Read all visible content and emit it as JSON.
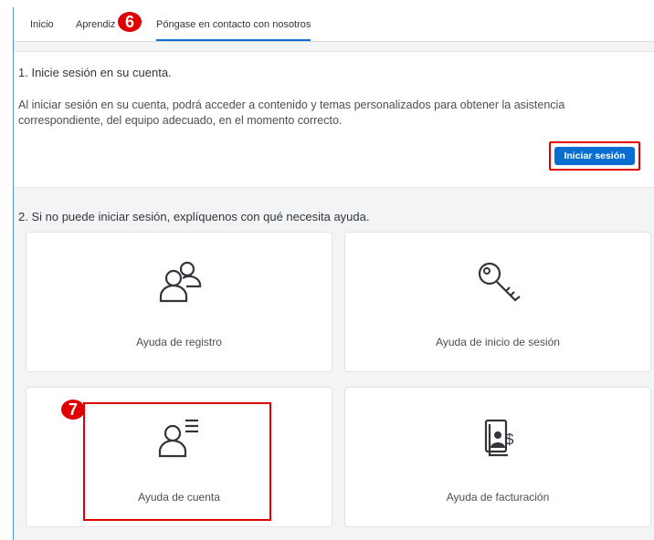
{
  "tabs": [
    {
      "label": "Inicio"
    },
    {
      "label": "Aprendiz"
    },
    {
      "label": "Póngase en contacto con nosotros"
    }
  ],
  "markers": {
    "m6": "6",
    "m7": "7"
  },
  "section1": {
    "title": "1. Inicie sesión en su cuenta.",
    "text": "Al iniciar sesión en su cuenta, podrá acceder a contenido y temas personalizados para obtener la asistencia correspondiente, del equipo adecuado, en el momento correcto.",
    "login_label": "Iniciar sesión"
  },
  "section2": {
    "title": "2. Si no puede iniciar sesión, explíquenos con qué necesita ayuda.",
    "cards": [
      {
        "label": "Ayuda de registro",
        "icon": "users-icon"
      },
      {
        "label": "Ayuda de inicio de sesión",
        "icon": "key-icon"
      },
      {
        "label": "Ayuda de cuenta",
        "icon": "account-list-icon"
      },
      {
        "label": "Ayuda de facturación",
        "icon": "billing-document-icon"
      }
    ]
  },
  "colors": {
    "accent": "#0a6ed1",
    "highlight": "#e00000"
  }
}
